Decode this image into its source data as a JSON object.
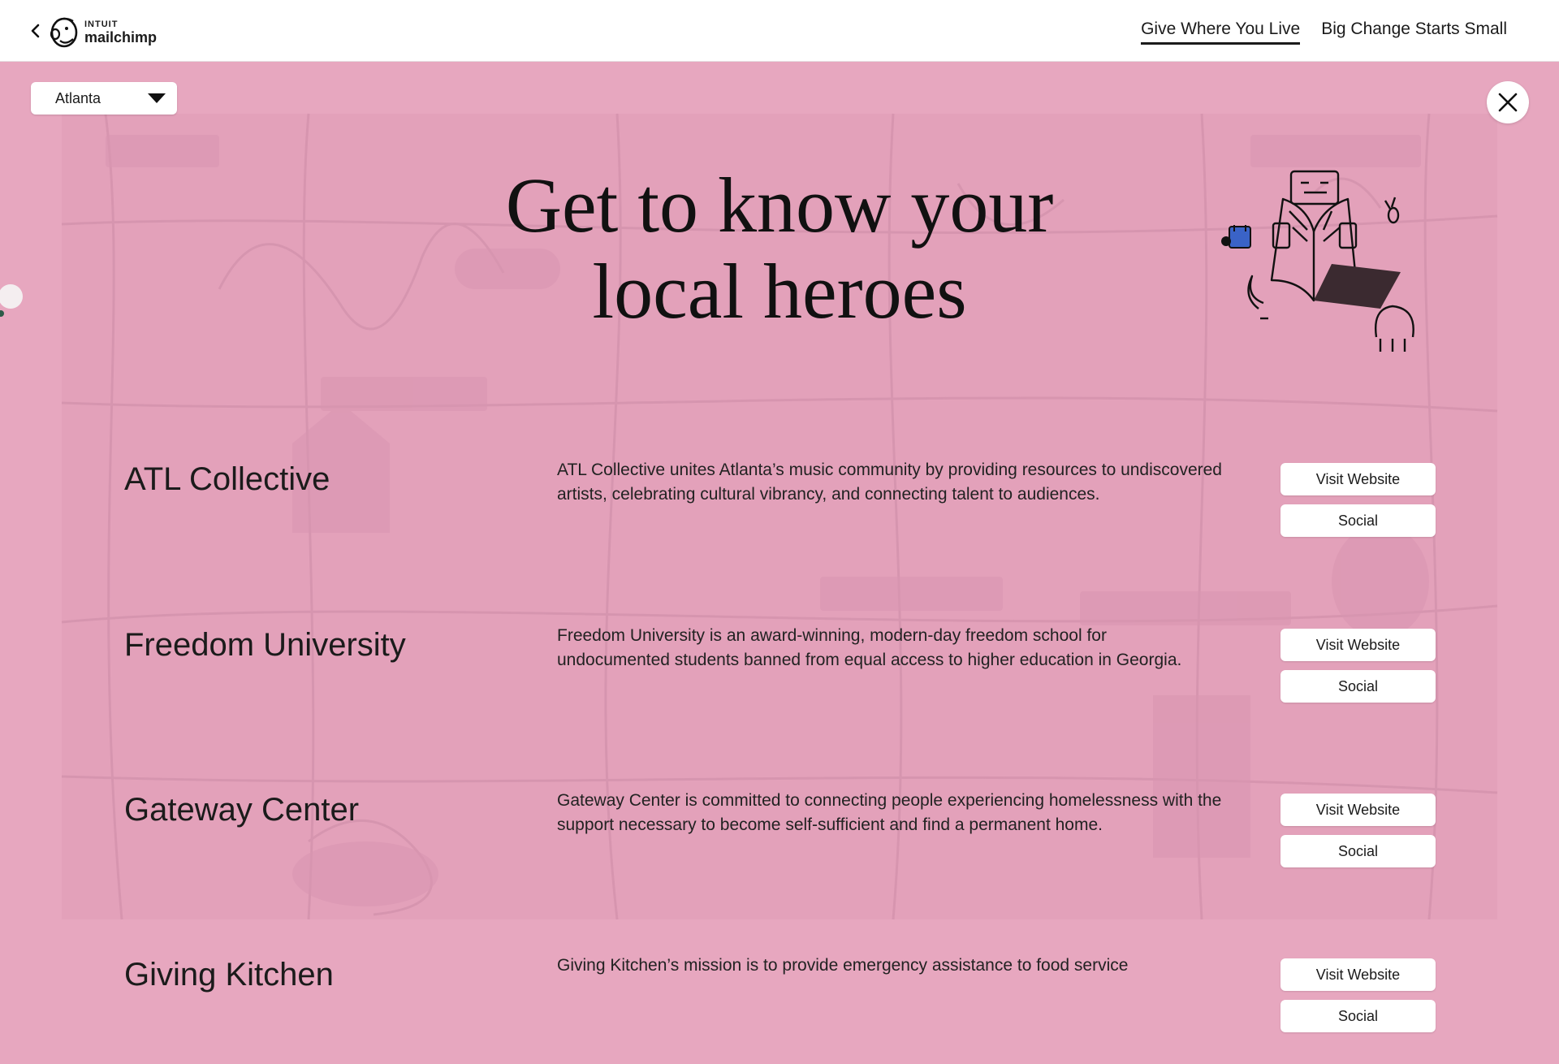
{
  "header": {
    "logo_top": "INTUIT",
    "logo_bottom": "mailchimp",
    "nav": [
      {
        "label": "Give Where You Live",
        "active": true
      },
      {
        "label": "Big Change Starts Small",
        "active": false
      }
    ]
  },
  "city_select": {
    "value": "Atlanta"
  },
  "headline": {
    "line1": "Get to know your",
    "line2": "local heroes"
  },
  "organizations": [
    {
      "name": "ATL Collective",
      "description": "ATL Collective unites Atlanta’s music community by providing resources to undiscovered artists, celebrating cultural vibrancy, and connecting talent to audiences.",
      "visit_label": "Visit Website",
      "social_label": "Social"
    },
    {
      "name": "Freedom University",
      "description": "Freedom University is an award-winning, modern-day freedom school for undocumented students banned from equal access to higher education in Georgia.",
      "visit_label": "Visit Website",
      "social_label": "Social"
    },
    {
      "name": "Gateway Center",
      "description": "Gateway Center is committed to connecting people experiencing homelessness with the support necessary to become self-sufficient and find a permanent home.",
      "visit_label": "Visit Website",
      "social_label": "Social"
    },
    {
      "name": "Giving Kitchen",
      "description": "Giving Kitchen’s mission is to provide emergency assistance to food service",
      "visit_label": "Visit Website",
      "social_label": "Social"
    }
  ],
  "colors": {
    "background": "#e7a7bf",
    "text": "#1b1b1b",
    "accent": "#3a63c7"
  }
}
